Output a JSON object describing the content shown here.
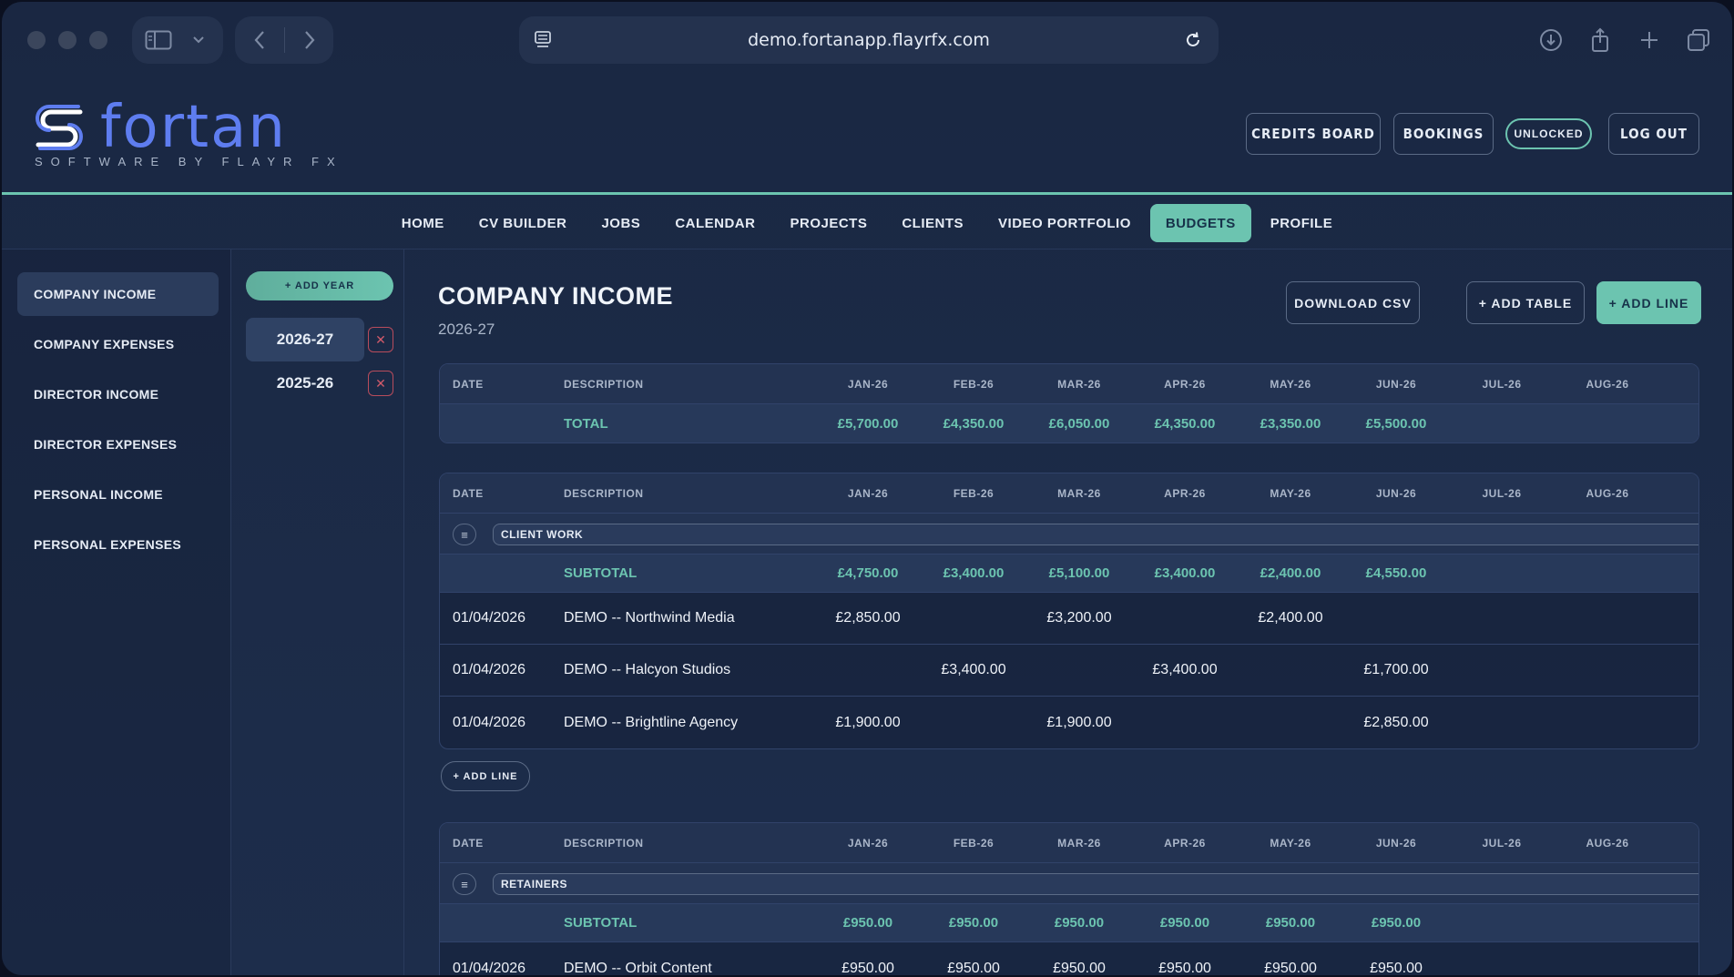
{
  "browser": {
    "url": "demo.fortanapp.flayrfx.com"
  },
  "brand": {
    "wordmark": "fortan",
    "tagline": "SOFTWARE BY FLAYR FX",
    "accent": "#6cc4b0",
    "logo_blue": "#5e7df0"
  },
  "header": {
    "credits_board": "CREDITS BOARD",
    "bookings": "BOOKINGS",
    "unlocked": "UNLOCKED",
    "log_out": "LOG OUT"
  },
  "nav": [
    "HOME",
    "CV BUILDER",
    "JOBS",
    "CALENDAR",
    "PROJECTS",
    "CLIENTS",
    "VIDEO PORTFOLIO",
    "BUDGETS",
    "PROFILE"
  ],
  "nav_active": "BUDGETS",
  "sidebar": [
    "COMPANY INCOME",
    "COMPANY EXPENSES",
    "DIRECTOR INCOME",
    "DIRECTOR EXPENSES",
    "PERSONAL INCOME",
    "PERSONAL EXPENSES"
  ],
  "years": {
    "add_label": "+ ADD YEAR",
    "items": [
      "2026-27",
      "2025-26"
    ],
    "delete_glyph": "✕"
  },
  "page": {
    "title": "COMPANY INCOME",
    "subtitle": "2026-27",
    "download_csv": "DOWNLOAD CSV",
    "add_table": "+ ADD TABLE",
    "add_line": "+ ADD LINE"
  },
  "columns": {
    "date": "DATE",
    "description": "DESCRIPTION",
    "months": [
      "JAN-26",
      "FEB-26",
      "MAR-26",
      "APR-26",
      "MAY-26",
      "JUN-26",
      "JUL-26",
      "AUG-26"
    ]
  },
  "summary": {
    "label": "TOTAL",
    "values": [
      "£5,700.00",
      "£4,350.00",
      "£6,050.00",
      "£4,350.00",
      "£3,350.00",
      "£5,500.00",
      "",
      ""
    ]
  },
  "tables": [
    {
      "group": "CLIENT WORK",
      "subtotal_label": "SUBTOTAL",
      "subtotal": [
        "£4,750.00",
        "£3,400.00",
        "£5,100.00",
        "£3,400.00",
        "£2,400.00",
        "£4,550.00",
        "",
        ""
      ],
      "rows": [
        {
          "date": "01/04/2026",
          "desc": "DEMO -- Northwind Media",
          "values": [
            "£2,850.00",
            "",
            "£3,200.00",
            "",
            "£2,400.00",
            "",
            "",
            ""
          ]
        },
        {
          "date": "01/04/2026",
          "desc": "DEMO -- Halcyon Studios",
          "values": [
            "",
            "£3,400.00",
            "",
            "£3,400.00",
            "",
            "£1,700.00",
            "",
            ""
          ]
        },
        {
          "date": "01/04/2026",
          "desc": "DEMO -- Brightline Agency",
          "values": [
            "£1,900.00",
            "",
            "£1,900.00",
            "",
            "",
            "£2,850.00",
            "",
            ""
          ]
        }
      ],
      "add_line": "+ ADD LINE"
    },
    {
      "group": "RETAINERS",
      "subtotal_label": "SUBTOTAL",
      "subtotal": [
        "£950.00",
        "£950.00",
        "£950.00",
        "£950.00",
        "£950.00",
        "£950.00",
        "",
        ""
      ],
      "rows": [
        {
          "date": "01/04/2026",
          "desc": "DEMO -- Orbit Content",
          "values": [
            "£950.00",
            "£950.00",
            "£950.00",
            "£950.00",
            "£950.00",
            "£950.00",
            "",
            ""
          ]
        }
      ]
    }
  ]
}
